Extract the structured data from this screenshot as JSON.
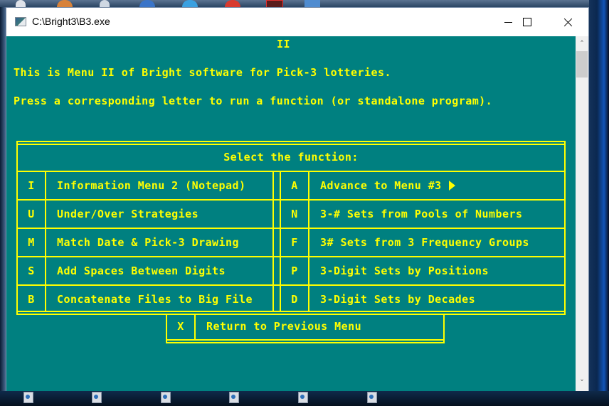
{
  "window": {
    "title": "C:\\Bright3\\B3.exe",
    "controls": {
      "minimize": "minimize",
      "maximize": "maximize",
      "close": "close"
    }
  },
  "console": {
    "menu_code": "II",
    "intro_line": "This is Menu II of Bright software for Pick-3 lotteries.",
    "instruction_line": "Press a corresponding letter to run a function (or standalone program).",
    "box_header": "Select the function:",
    "left_items": [
      {
        "key": "I",
        "label": "Information Menu 2 (Notepad)"
      },
      {
        "key": "U",
        "label": "Under/Over Strategies"
      },
      {
        "key": "M",
        "label": "Match Date & Pick-3 Drawing"
      },
      {
        "key": "S",
        "label": "Add Spaces Between Digits"
      },
      {
        "key": "B",
        "label": "Concatenate Files to Big File"
      }
    ],
    "right_items": [
      {
        "key": "A",
        "label": "Advance to Menu #3",
        "icon": "right-triangle-icon"
      },
      {
        "key": "N",
        "label": "3-# Sets from Pools of Numbers"
      },
      {
        "key": "F",
        "label": "3# Sets from 3 Frequency Groups"
      },
      {
        "key": "P",
        "label": "3-Digit Sets by Positions"
      },
      {
        "key": "D",
        "label": "3-Digit Sets by Decades"
      }
    ],
    "return_item": {
      "key": "X",
      "label": "Return to Previous Menu"
    }
  },
  "colors": {
    "console_bg": "#008080",
    "console_text": "#ffff00",
    "titlebar_bg": "#ffffff"
  }
}
